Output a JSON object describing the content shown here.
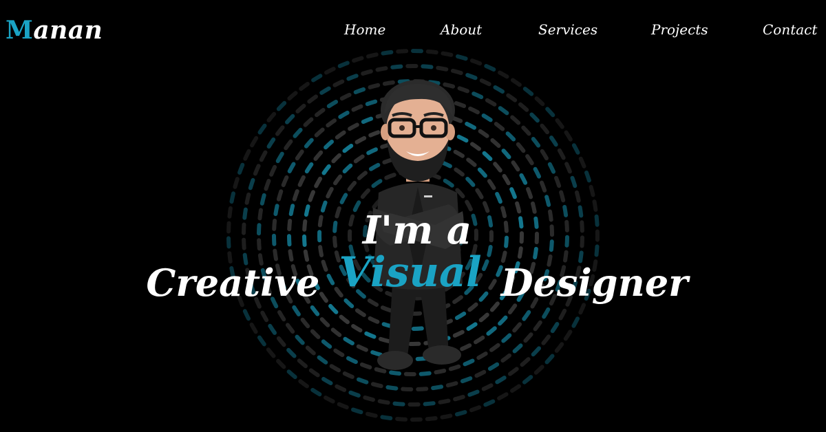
{
  "brand": {
    "logo_first": "M",
    "logo_rest": "anan",
    "accent_color": "#1aa3c4"
  },
  "nav": {
    "items": [
      {
        "label": "Home"
      },
      {
        "label": "About"
      },
      {
        "label": "Services"
      },
      {
        "label": "Projects"
      },
      {
        "label": "Contact"
      }
    ]
  },
  "hero": {
    "line1": "I'm a",
    "word1": "Creative",
    "word2": "Visual",
    "word3": "Designer",
    "avatar_icon": "bearded-man-avatar-icon",
    "background_icon": "radial-dash-rings-icon",
    "colors": {
      "background": "#000000",
      "text": "#ffffff",
      "highlight": "#1aa3c4",
      "ring_gray": "#5e5e5e"
    }
  }
}
